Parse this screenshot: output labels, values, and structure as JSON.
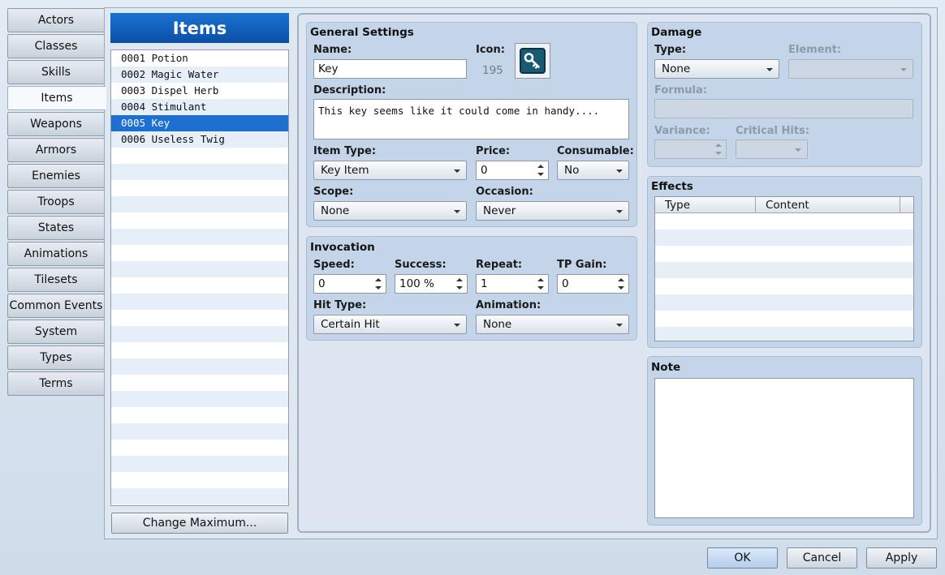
{
  "tabs": [
    "Actors",
    "Classes",
    "Skills",
    "Items",
    "Weapons",
    "Armors",
    "Enemies",
    "Troops",
    "States",
    "Animations",
    "Tilesets",
    "Common Events",
    "System",
    "Types",
    "Terms"
  ],
  "active_tab": "Items",
  "list": {
    "title": "Items",
    "items": [
      "0001 Potion",
      "0002 Magic Water",
      "0003 Dispel Herb",
      "0004 Stimulant",
      "0005 Key",
      "0006 Useless Twig"
    ],
    "selected_index": 4,
    "change_max_label": "Change Maximum..."
  },
  "general": {
    "title": "General Settings",
    "name_label": "Name:",
    "name_value": "Key",
    "icon_label": "Icon:",
    "icon_index": "195",
    "icon_name": "key-icon",
    "description_label": "Description:",
    "description_value": "This key seems like it could come in handy....",
    "item_type_label": "Item Type:",
    "item_type_value": "Key Item",
    "price_label": "Price:",
    "price_value": "0",
    "consumable_label": "Consumable:",
    "consumable_value": "No",
    "scope_label": "Scope:",
    "scope_value": "None",
    "occasion_label": "Occasion:",
    "occasion_value": "Never"
  },
  "invocation": {
    "title": "Invocation",
    "speed_label": "Speed:",
    "speed_value": "0",
    "success_label": "Success:",
    "success_value": "100 %",
    "repeat_label": "Repeat:",
    "repeat_value": "1",
    "tp_gain_label": "TP Gain:",
    "tp_gain_value": "0",
    "hit_type_label": "Hit Type:",
    "hit_type_value": "Certain Hit",
    "animation_label": "Animation:",
    "animation_value": "None"
  },
  "damage": {
    "title": "Damage",
    "type_label": "Type:",
    "type_value": "None",
    "element_label": "Element:",
    "element_value": "",
    "formula_label": "Formula:",
    "formula_value": "",
    "variance_label": "Variance:",
    "variance_value": "",
    "critical_label": "Critical Hits:",
    "critical_value": ""
  },
  "effects": {
    "title": "Effects",
    "columns": [
      "Type",
      "Content"
    ]
  },
  "note": {
    "title": "Note",
    "value": ""
  },
  "footer": {
    "ok": "OK",
    "cancel": "Cancel",
    "apply": "Apply"
  },
  "colors": {
    "selection": "#1d6fd0",
    "header": "#0b4fa8",
    "group_bg": "#c4d5ea"
  }
}
